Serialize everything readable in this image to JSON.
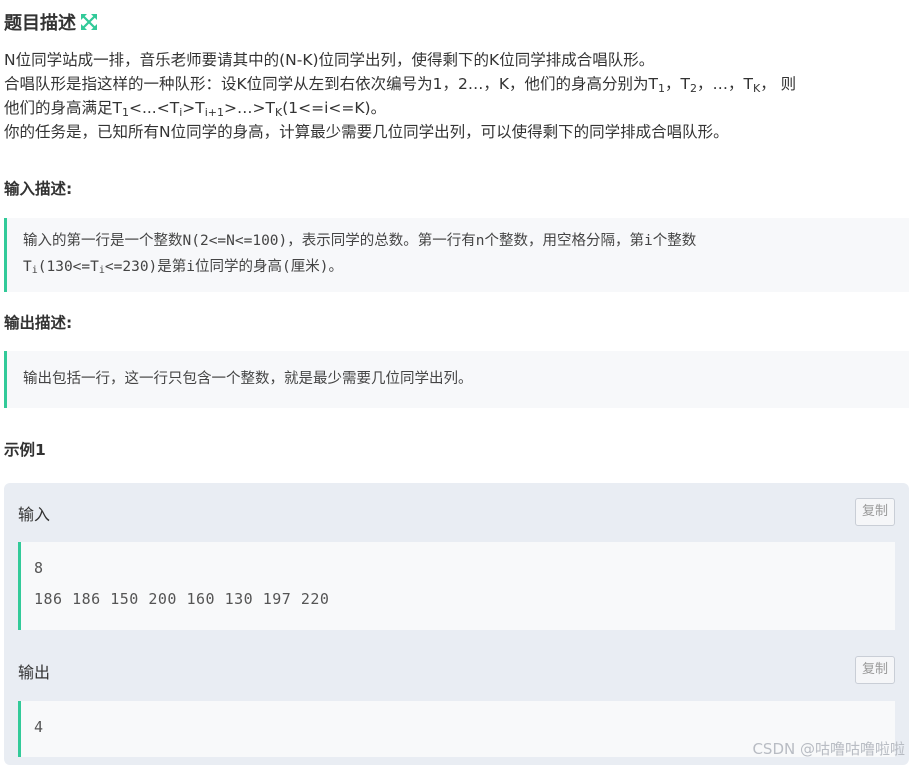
{
  "header": {
    "title": "题目描述",
    "icon": "expand-icon",
    "icon_color": "#32ca99"
  },
  "description": {
    "line1": "N位同学站成一排，音乐老师要请其中的(N-K)位同学出列，使得剩下的K位同学排成合唱队形。",
    "line2_pre": "合唱队形是指这样的一种队形：设K位同学从左到右依次编号为1，2…，K，他们的身高分别为T",
    "line2_sub1": "1",
    "line2_mid1": "，T",
    "line2_sub2": "2",
    "line2_mid2": "，…，T",
    "line2_sub3": "K",
    "line2_post": "，  则",
    "line3_pre": "他们的身高满足T",
    "line3_sub1": "1",
    "line3_mid1": "<...<T",
    "line3_sub2": "i",
    "line3_mid2": ">T",
    "line3_sub3": "i+1",
    "line3_mid3": ">…>T",
    "line3_sub4": "K",
    "line3_post": "(1<=i<=K)。",
    "line4": "你的任务是，已知所有N位同学的身高，计算最少需要几位同学出列，可以使得剩下的同学排成合唱队形。"
  },
  "input_section": {
    "title": "输入描述:",
    "line1": "输入的第一行是一个整数N(2<=N<=100)，表示同学的总数。第一行有n个整数，用空格分隔，第i个整数",
    "line2_pre": "T",
    "line2_sub1": "i",
    "line2_mid": "(130<=T",
    "line2_sub2": "i",
    "line2_post": "<=230)是第i位同学的身高(厘米)。"
  },
  "output_section": {
    "title": "输出描述:",
    "text": "输出包括一行，这一行只包含一个整数，就是最少需要几位同学出列。"
  },
  "example": {
    "title": "示例1",
    "input_label": "输入",
    "input_copy": "复制",
    "input_lines": [
      "8",
      "186 186 150 200 160 130 197 220"
    ],
    "output_label": "输出",
    "output_copy": "复制",
    "output_lines": [
      "4"
    ]
  },
  "watermark": "CSDN @咕噜咕噜啦啦",
  "colors": {
    "accent": "#32ca99",
    "quote_bg": "#f7f8fa",
    "example_bg": "#e9edf3"
  }
}
